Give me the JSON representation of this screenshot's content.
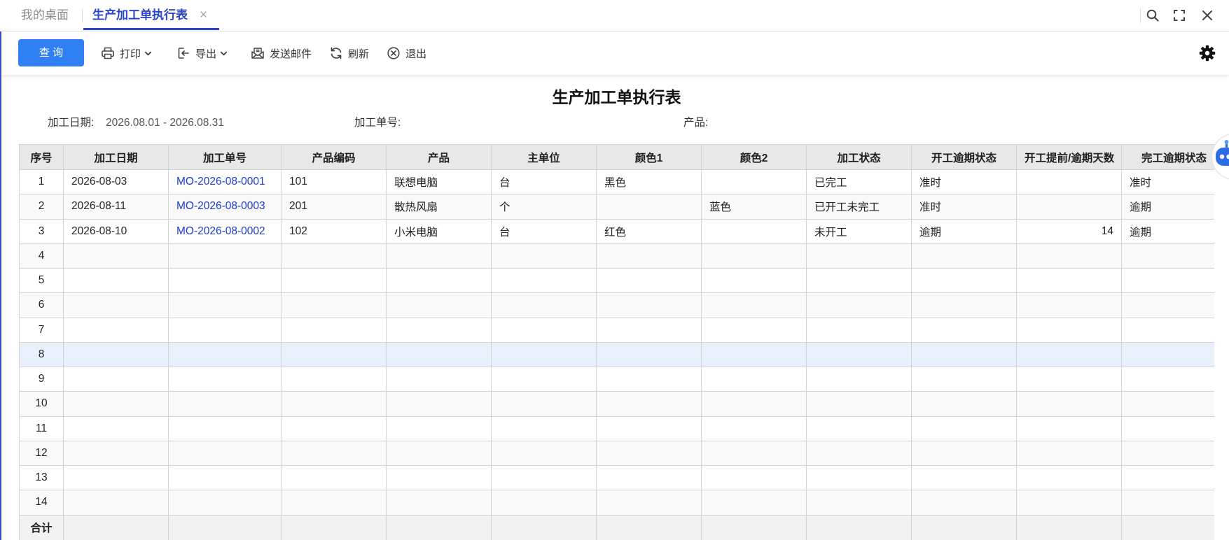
{
  "tabs": {
    "items": [
      {
        "label": "我的桌面",
        "active": false
      },
      {
        "label": "生产加工单执行表",
        "active": true
      }
    ],
    "close_glyph": "×"
  },
  "window_icons": [
    "search-icon",
    "fullscreen-icon",
    "close-icon"
  ],
  "toolbar": {
    "query_label": "查 询",
    "items": [
      {
        "label": "打印",
        "icon": "printer-icon",
        "dropdown": true
      },
      {
        "label": "导出",
        "icon": "export-icon",
        "dropdown": true
      },
      {
        "label": "发送邮件",
        "icon": "mail-icon",
        "dropdown": false
      },
      {
        "label": "刷新",
        "icon": "refresh-icon",
        "dropdown": false
      },
      {
        "label": "退出",
        "icon": "exit-icon",
        "dropdown": false
      }
    ],
    "settings_icon": "gear-icon"
  },
  "report": {
    "title": "生产加工单执行表",
    "filters": [
      {
        "label": "加工日期:",
        "value": "2026.08.01 - 2026.08.31"
      },
      {
        "label": "加工单号:",
        "value": ""
      },
      {
        "label": "产品:",
        "value": ""
      }
    ]
  },
  "table": {
    "columns": [
      "序号",
      "加工日期",
      "加工单号",
      "产品编码",
      "产品",
      "主单位",
      "颜色1",
      "颜色2",
      "加工状态",
      "开工逾期状态",
      "开工提前/逾期天数",
      "完工逾期状态"
    ],
    "rows": [
      {
        "cells": [
          "1",
          "2026-08-03",
          "MO-2026-08-0001",
          "101",
          "联想电脑",
          "台",
          "黑色",
          "",
          "已完工",
          "准时",
          "",
          "准时"
        ]
      },
      {
        "cells": [
          "2",
          "2026-08-11",
          "MO-2026-08-0003",
          "201",
          "散热风扇",
          "个",
          "",
          "蓝色",
          "已开工未完工",
          "准时",
          "",
          "逾期"
        ]
      },
      {
        "cells": [
          "3",
          "2026-08-10",
          "MO-2026-08-0002",
          "102",
          "小米电脑",
          "台",
          "红色",
          "",
          "未开工",
          "逾期",
          "14",
          "逾期"
        ]
      },
      {
        "cells": [
          "4",
          "",
          "",
          "",
          "",
          "",
          "",
          "",
          "",
          "",
          "",
          ""
        ]
      },
      {
        "cells": [
          "5",
          "",
          "",
          "",
          "",
          "",
          "",
          "",
          "",
          "",
          "",
          ""
        ]
      },
      {
        "cells": [
          "6",
          "",
          "",
          "",
          "",
          "",
          "",
          "",
          "",
          "",
          "",
          ""
        ]
      },
      {
        "cells": [
          "7",
          "",
          "",
          "",
          "",
          "",
          "",
          "",
          "",
          "",
          "",
          ""
        ]
      },
      {
        "cells": [
          "8",
          "",
          "",
          "",
          "",
          "",
          "",
          "",
          "",
          "",
          "",
          ""
        ],
        "highlighted": true
      },
      {
        "cells": [
          "9",
          "",
          "",
          "",
          "",
          "",
          "",
          "",
          "",
          "",
          "",
          ""
        ]
      },
      {
        "cells": [
          "10",
          "",
          "",
          "",
          "",
          "",
          "",
          "",
          "",
          "",
          "",
          ""
        ]
      },
      {
        "cells": [
          "11",
          "",
          "",
          "",
          "",
          "",
          "",
          "",
          "",
          "",
          "",
          ""
        ]
      },
      {
        "cells": [
          "12",
          "",
          "",
          "",
          "",
          "",
          "",
          "",
          "",
          "",
          "",
          ""
        ]
      },
      {
        "cells": [
          "13",
          "",
          "",
          "",
          "",
          "",
          "",
          "",
          "",
          "",
          "",
          ""
        ]
      },
      {
        "cells": [
          "14",
          "",
          "",
          "",
          "",
          "",
          "",
          "",
          "",
          "",
          "",
          ""
        ]
      }
    ],
    "footer_label": "合计"
  },
  "floating_assistant_icon": "robot-assistant-icon",
  "colors": {
    "accent": "#2f80f5",
    "active_tab": "#2b45c8",
    "link": "#1d3ccf",
    "table_header_bg": "#e8e8e8",
    "hover_row_bg": "#e9f0fb",
    "grid_line": "#d3d3d3"
  }
}
